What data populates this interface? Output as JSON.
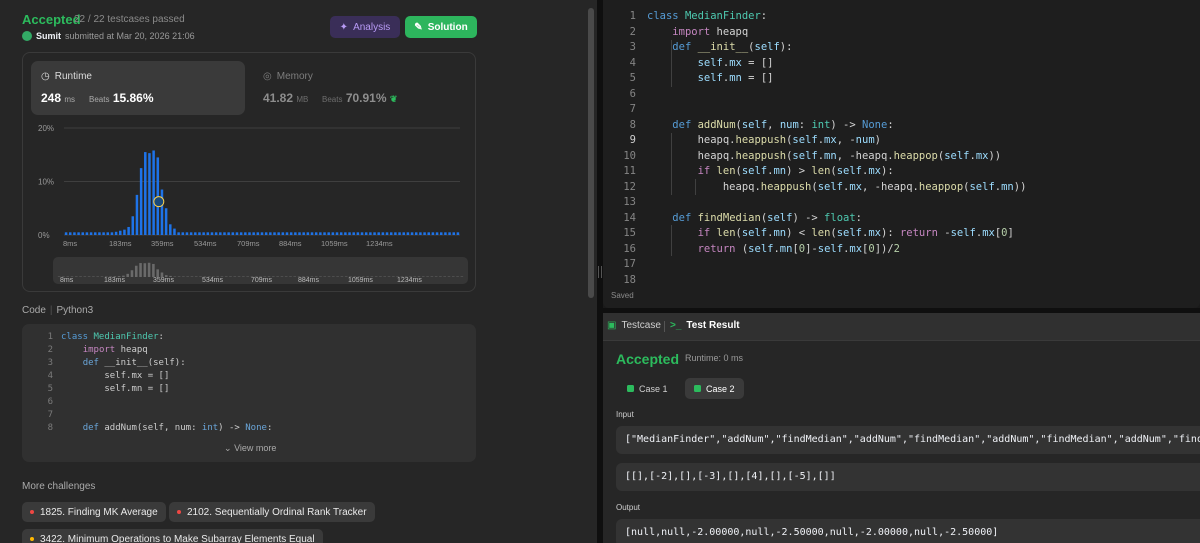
{
  "submission": {
    "status": "Accepted",
    "testcases": "22 / 22 testcases passed",
    "user": "Sumit",
    "submitted_text": "submitted at Mar 20, 2026 21:06",
    "analysis_label": "Analysis",
    "solution_label": "Solution"
  },
  "runtime": {
    "title": "Runtime",
    "value": "248",
    "unit": "ms",
    "beats_label": "Beats",
    "beats": "15.86%"
  },
  "memory": {
    "title": "Memory",
    "value": "41.82",
    "unit": "MB",
    "beats_label": "Beats",
    "beats": "70.91%"
  },
  "chart_data": {
    "type": "bar",
    "yticks": [
      "20%",
      "10%",
      "0%"
    ],
    "ylim": [
      0,
      20
    ],
    "xticks": [
      "8ms",
      "183ms",
      "359ms",
      "534ms",
      "709ms",
      "884ms",
      "1059ms",
      "1234ms"
    ],
    "values": [
      0.5,
      0.5,
      0.5,
      0.5,
      0.5,
      0.5,
      0.5,
      0.5,
      0.5,
      0.5,
      0.5,
      0.5,
      0.6,
      0.8,
      1.0,
      1.5,
      3.5,
      7.5,
      12.5,
      15.5,
      15.3,
      15.8,
      14.5,
      8.5,
      5.0,
      2.0,
      1.2,
      0.5,
      0.5,
      0.5,
      0.5,
      0.5,
      0.5,
      0.5,
      0.5,
      0.5,
      0.5,
      0.5,
      0.5,
      0.5,
      0.5,
      0.5,
      0.5,
      0.5,
      0.5,
      0.5,
      0.5,
      0.5,
      0.5,
      0.5,
      0.5,
      0.5,
      0.5,
      0.5,
      0.5,
      0.5,
      0.5,
      0.5,
      0.5,
      0.5,
      0.5,
      0.5,
      0.5,
      0.5,
      0.5,
      0.5,
      0.5,
      0.5,
      0.5,
      0.5,
      0.5,
      0.5,
      0.5,
      0.5,
      0.5,
      0.5,
      0.5,
      0.5,
      0.5,
      0.5,
      0.5,
      0.5,
      0.5,
      0.5,
      0.5,
      0.5,
      0.5,
      0.5,
      0.5,
      0.5,
      0.5,
      0.5,
      0.5,
      0.5,
      0.5
    ],
    "highlight_index": 22,
    "bar_color": "#1e73e8",
    "grid": true
  },
  "minimap_labels": [
    "8ms",
    "183ms",
    "359ms",
    "534ms",
    "709ms",
    "884ms",
    "1059ms",
    "1234ms"
  ],
  "code_preview": {
    "header": "Code",
    "language": "Python3",
    "lines": [
      [
        [
          "kb",
          "class "
        ],
        [
          "cls",
          "MedianFinder"
        ],
        [
          "tx",
          ":"
        ]
      ],
      [
        [
          "tx",
          "    "
        ],
        [
          "lp",
          "import"
        ],
        [
          "tx",
          " heapq"
        ]
      ],
      [
        [
          "tx",
          "    "
        ],
        [
          "lb",
          "def"
        ],
        [
          "tx",
          " __init__(self):"
        ]
      ],
      [
        [
          "tx",
          "        self.mx = []"
        ]
      ],
      [
        [
          "tx",
          "        self.mn = []"
        ]
      ],
      [
        [
          "tx",
          ""
        ]
      ],
      [
        [
          "tx",
          ""
        ]
      ],
      [
        [
          "tx",
          "    "
        ],
        [
          "lb",
          "def"
        ],
        [
          "tx",
          " addNum(self, num: "
        ],
        [
          "lb",
          "int"
        ],
        [
          "tx",
          ") -> "
        ],
        [
          "lb",
          "None"
        ],
        [
          "tx",
          ":"
        ]
      ]
    ],
    "view_more": "View more"
  },
  "more_challenges": {
    "title": "More challenges",
    "items": [
      {
        "label": "1825. Finding MK Average",
        "difficulty": "hard"
      },
      {
        "label": "2102. Sequentially Ordinal Rank Tracker",
        "difficulty": "hard"
      },
      {
        "label": "3422. Minimum Operations to Make Subarray Elements Equal",
        "difficulty": "medium"
      }
    ]
  },
  "editor": {
    "current_line": 9,
    "lines": [
      [
        [
          "kb",
          "class "
        ],
        [
          "cls",
          "MedianFinder"
        ],
        [
          "tx",
          ":"
        ]
      ],
      [
        [
          "tx",
          "    "
        ],
        [
          "kw",
          "import"
        ],
        [
          "tx",
          " heapq"
        ]
      ],
      [
        [
          "tx",
          "    "
        ],
        [
          "kb",
          "def "
        ],
        [
          "fn",
          "__init__"
        ],
        [
          "tx",
          "("
        ],
        [
          "sf",
          "self"
        ],
        [
          "tx",
          "):"
        ]
      ],
      [
        [
          "tx",
          "        "
        ],
        [
          "sf",
          "self"
        ],
        [
          "tx",
          "."
        ],
        [
          "vr",
          "mx"
        ],
        [
          "tx",
          " = []"
        ]
      ],
      [
        [
          "tx",
          "        "
        ],
        [
          "sf",
          "self"
        ],
        [
          "tx",
          "."
        ],
        [
          "vr",
          "mn"
        ],
        [
          "tx",
          " = []"
        ]
      ],
      [
        [
          "tx",
          ""
        ]
      ],
      [
        [
          "tx",
          ""
        ]
      ],
      [
        [
          "tx",
          "    "
        ],
        [
          "kb",
          "def "
        ],
        [
          "fn",
          "addNum"
        ],
        [
          "tx",
          "("
        ],
        [
          "sf",
          "self"
        ],
        [
          "tx",
          ", "
        ],
        [
          "vr",
          "num"
        ],
        [
          "tx",
          ": "
        ],
        [
          "cls",
          "int"
        ],
        [
          "tx",
          ") -> "
        ],
        [
          "kb",
          "None"
        ],
        [
          "tx",
          ":"
        ]
      ],
      [
        [
          "tx",
          "        heapq."
        ],
        [
          "fn",
          "heappush"
        ],
        [
          "tx",
          "("
        ],
        [
          "sf",
          "self"
        ],
        [
          "tx",
          "."
        ],
        [
          "vr",
          "mx"
        ],
        [
          "tx",
          ", -"
        ],
        [
          "vr",
          "num"
        ],
        [
          "tx",
          ")"
        ]
      ],
      [
        [
          "tx",
          "        heapq."
        ],
        [
          "fn",
          "heappush"
        ],
        [
          "tx",
          "("
        ],
        [
          "sf",
          "self"
        ],
        [
          "tx",
          "."
        ],
        [
          "vr",
          "mn"
        ],
        [
          "tx",
          ", -heapq."
        ],
        [
          "fn",
          "heappop"
        ],
        [
          "tx",
          "("
        ],
        [
          "sf",
          "self"
        ],
        [
          "tx",
          "."
        ],
        [
          "vr",
          "mx"
        ],
        [
          "tx",
          "))"
        ]
      ],
      [
        [
          "tx",
          "        "
        ],
        [
          "kw",
          "if "
        ],
        [
          "fn",
          "len"
        ],
        [
          "tx",
          "("
        ],
        [
          "sf",
          "self"
        ],
        [
          "tx",
          "."
        ],
        [
          "vr",
          "mn"
        ],
        [
          "tx",
          ") > "
        ],
        [
          "fn",
          "len"
        ],
        [
          "tx",
          "("
        ],
        [
          "sf",
          "self"
        ],
        [
          "tx",
          "."
        ],
        [
          "vr",
          "mx"
        ],
        [
          "tx",
          "):"
        ]
      ],
      [
        [
          "tx",
          "            heapq."
        ],
        [
          "fn",
          "heappush"
        ],
        [
          "tx",
          "("
        ],
        [
          "sf",
          "self"
        ],
        [
          "tx",
          "."
        ],
        [
          "vr",
          "mx"
        ],
        [
          "tx",
          ", -heapq."
        ],
        [
          "fn",
          "heappop"
        ],
        [
          "tx",
          "("
        ],
        [
          "sf",
          "self"
        ],
        [
          "tx",
          "."
        ],
        [
          "vr",
          "mn"
        ],
        [
          "tx",
          "))"
        ]
      ],
      [
        [
          "tx",
          ""
        ]
      ],
      [
        [
          "tx",
          "    "
        ],
        [
          "kb",
          "def "
        ],
        [
          "fn",
          "findMedian"
        ],
        [
          "tx",
          "("
        ],
        [
          "sf",
          "self"
        ],
        [
          "tx",
          ") -> "
        ],
        [
          "cls",
          "float"
        ],
        [
          "tx",
          ":"
        ]
      ],
      [
        [
          "tx",
          "        "
        ],
        [
          "kw",
          "if "
        ],
        [
          "fn",
          "len"
        ],
        [
          "tx",
          "("
        ],
        [
          "sf",
          "self"
        ],
        [
          "tx",
          "."
        ],
        [
          "vr",
          "mn"
        ],
        [
          "tx",
          ") < "
        ],
        [
          "fn",
          "len"
        ],
        [
          "tx",
          "("
        ],
        [
          "sf",
          "self"
        ],
        [
          "tx",
          "."
        ],
        [
          "vr",
          "mx"
        ],
        [
          "tx",
          "): "
        ],
        [
          "kw",
          "return"
        ],
        [
          "tx",
          " -"
        ],
        [
          "sf",
          "self"
        ],
        [
          "tx",
          "."
        ],
        [
          "vr",
          "mx"
        ],
        [
          "tx",
          "["
        ],
        [
          "nm",
          "0"
        ],
        [
          "tx",
          "]"
        ]
      ],
      [
        [
          "tx",
          "        "
        ],
        [
          "kw",
          "return"
        ],
        [
          "tx",
          " ("
        ],
        [
          "sf",
          "self"
        ],
        [
          "tx",
          "."
        ],
        [
          "vr",
          "mn"
        ],
        [
          "tx",
          "["
        ],
        [
          "nm",
          "0"
        ],
        [
          "tx",
          "]-"
        ],
        [
          "sf",
          "self"
        ],
        [
          "tx",
          "."
        ],
        [
          "vr",
          "mx"
        ],
        [
          "tx",
          "["
        ],
        [
          "nm",
          "0"
        ],
        [
          "tx",
          "])/"
        ],
        [
          "nm",
          "2"
        ]
      ],
      [
        [
          "tx",
          ""
        ]
      ],
      [
        [
          "tx",
          ""
        ]
      ]
    ],
    "status": "Saved"
  },
  "result_panel": {
    "tab_testcase": "Testcase",
    "tab_result": "Test Result",
    "status": "Accepted",
    "runtime": "Runtime: 0 ms",
    "cases": [
      "Case 1",
      "Case 2"
    ],
    "input_label": "Input",
    "input_line1": "[\"MedianFinder\",\"addNum\",\"findMedian\",\"addNum\",\"findMedian\",\"addNum\",\"findMedian\",\"addNum\",\"findMedian\"]",
    "input_line2": "[[],[-2],[],[-3],[],[4],[],[-5],[]]",
    "output_label": "Output",
    "output": "[null,null,-2.00000,null,-2.50000,null,-2.00000,null,-2.50000]"
  },
  "colors": {
    "accepted": "#2cbb5d",
    "solution_button": "#2db55d",
    "analysis_button": "#3a2e58",
    "chart_bar": "#1e73e8"
  }
}
